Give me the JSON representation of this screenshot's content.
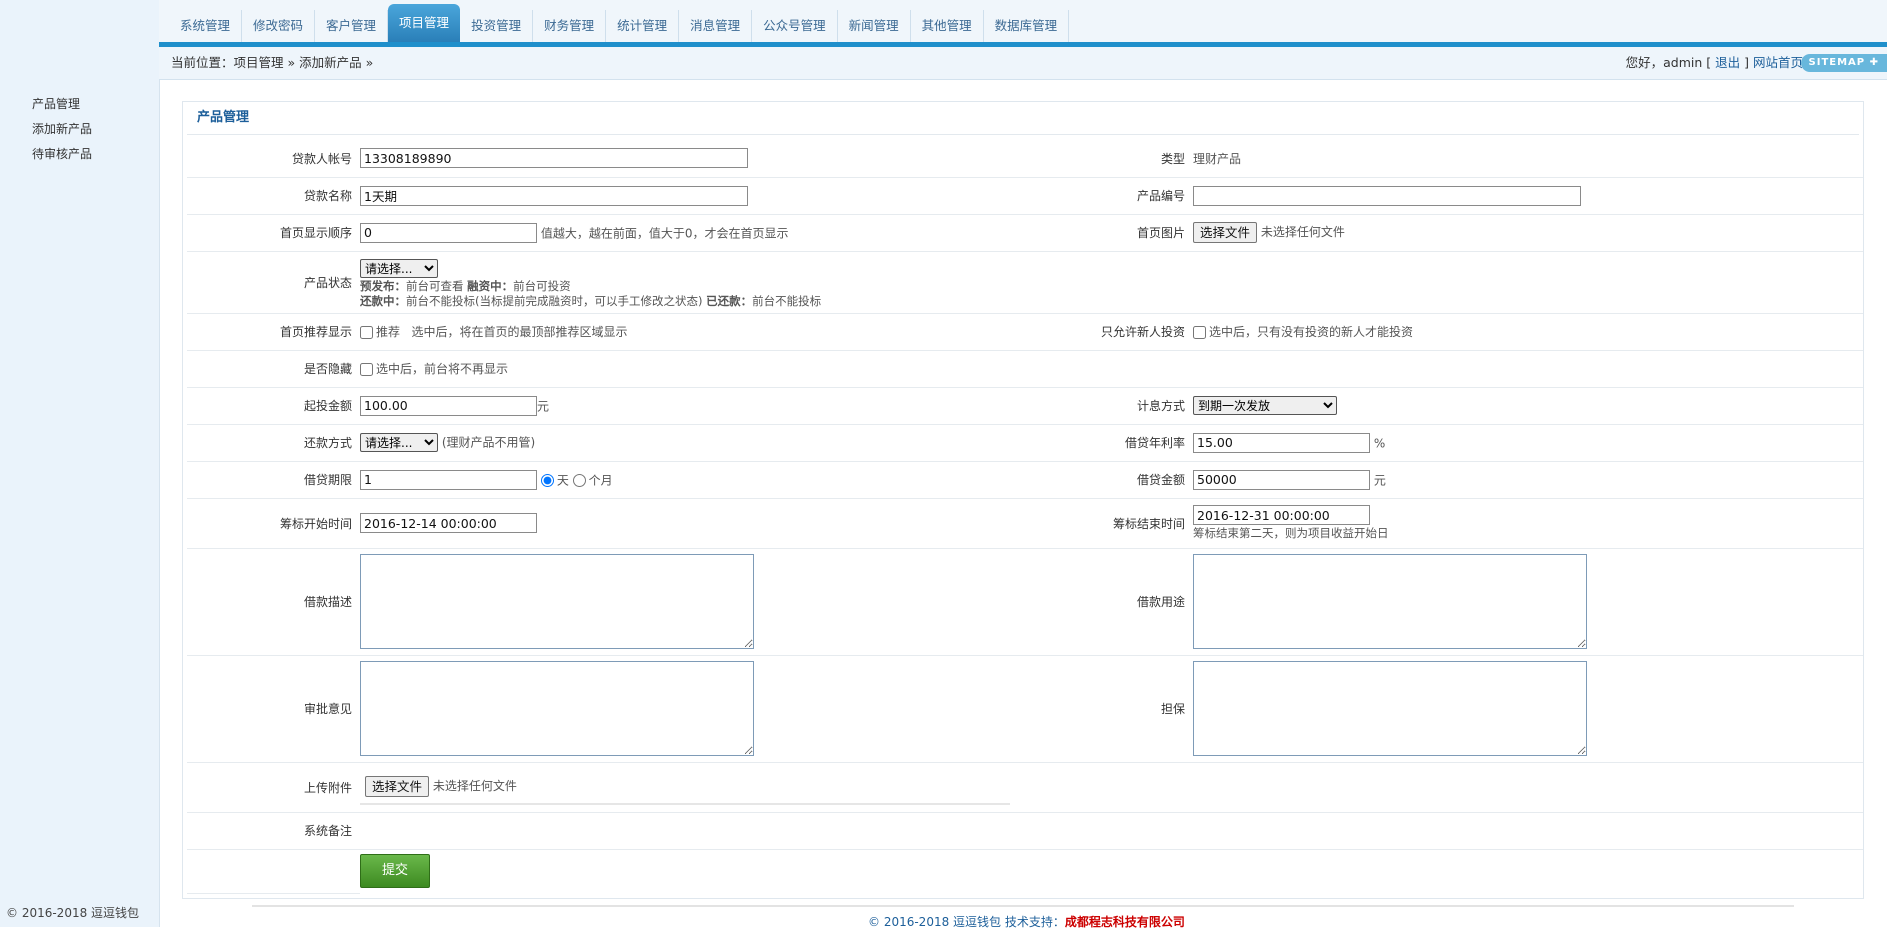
{
  "nav": {
    "tabs": [
      "系统管理",
      "修改密码",
      "客户管理",
      "项目管理",
      "投资管理",
      "财务管理",
      "统计管理",
      "消息管理",
      "公众号管理",
      "新闻管理",
      "其他管理",
      "数据库管理"
    ],
    "active_index": 3
  },
  "breadcrumb": "当前位置：项目管理 » 添加新产品 »",
  "user": {
    "greeting": "您好，admin [",
    "logout": "退出",
    "close_bracket": "]",
    "site_home": "网站首页",
    "sitemap": "SITEMAP ✚"
  },
  "sidebar": {
    "items": [
      "产品管理",
      "添加新产品",
      "待审核产品"
    ],
    "copyright": "© 2016-2018 逗逗钱包"
  },
  "panel_title": "产品管理",
  "form": {
    "borrower_account_label": "贷款人帐号",
    "borrower_account_value": "13308189890",
    "type_label": "类型",
    "type_value": "理财产品",
    "loan_name_label": "贷款名称",
    "loan_name_value": "1天期",
    "product_code_label": "产品编号",
    "product_code_value": "",
    "home_order_label": "首页显示顺序",
    "home_order_value": "0",
    "home_order_note": "值越大，越在前面，值大于0，才会在首页显示",
    "home_image_label": "首页图片",
    "choose_file": "选择文件",
    "no_file": "未选择任何文件",
    "status_label": "产品状态",
    "status_select": "请选择...",
    "status_note_1_key": "预发布：",
    "status_note_1_val": "前台可查看 ",
    "status_note_2_key": "融资中：",
    "status_note_2_val": "前台可投资",
    "status_note_3_key": "还款中：",
    "status_note_3_val": "前台不能投标(当标提前完成融资时，可以手工修改之状态) ",
    "status_note_4_key": "已还款：",
    "status_note_4_val": "前台不能投标",
    "recommend_label": "首页推荐显示",
    "recommend_option": "推荐",
    "recommend_note": "选中后，将在首页的最顶部推荐区域显示",
    "newbie_label": "只允许新人投资",
    "newbie_note": "选中后，只有没有投资的新人才能投资",
    "hidden_label": "是否隐藏",
    "hidden_note": "选中后，前台将不再显示",
    "min_invest_label": "起投金额",
    "min_invest_value": "100.00",
    "unit_yuan": "元",
    "interest_method_label": "计息方式",
    "interest_method_value": "到期一次发放",
    "repay_method_label": "还款方式",
    "repay_method_value": "请选择...",
    "repay_method_note": "(理财产品不用管)",
    "annual_rate_label": "借贷年利率",
    "annual_rate_value": "15.00",
    "unit_percent": "%",
    "period_label": "借贷期限",
    "period_value": "1",
    "period_day": "天",
    "period_month": "个月",
    "amount_label": "借贷金额",
    "amount_value": "50000",
    "start_time_label": "筹标开始时间",
    "start_time_value": "2016-12-14 00:00:00",
    "end_time_label": "筹标结束时间",
    "end_time_value": "2016-12-31 00:00:00",
    "end_time_note": "筹标结束第二天，则为项目收益开始日",
    "description_label": "借款描述",
    "purpose_label": "借款用途",
    "approval_label": "审批意见",
    "guarantee_label": "担保",
    "attachment_label": "上传附件",
    "remark_label": "系统备注",
    "submit": "提交"
  },
  "footer": {
    "text": "© 2016-2018 逗逗钱包 技术支持：",
    "company": "成都程志科技有限公司"
  }
}
